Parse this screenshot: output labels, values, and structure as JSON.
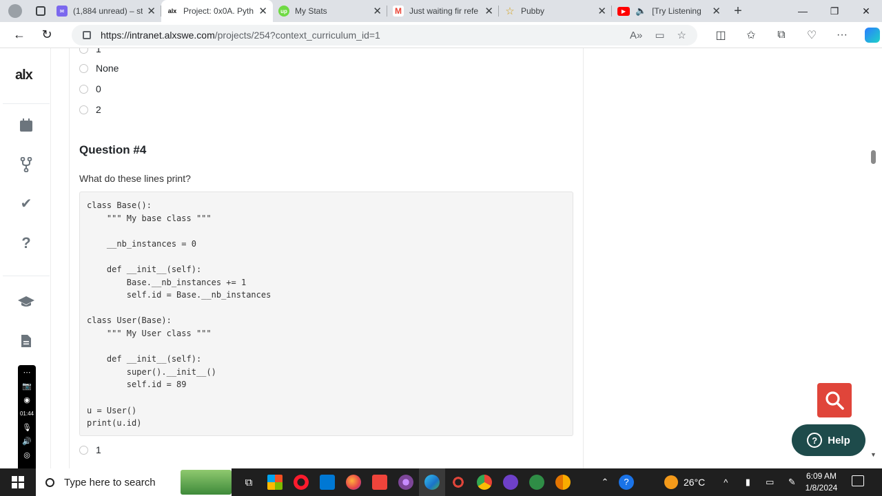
{
  "browser": {
    "tabs": [
      {
        "title": "(1,884 unread) – st",
        "favicon": "mail-icon",
        "color": "#7b68ee",
        "active": false
      },
      {
        "title": "Project: 0x0A. Pyth",
        "favicon": "alx-icon",
        "color": "#111111",
        "active": true
      },
      {
        "title": "My Stats",
        "favicon": "upwork-icon",
        "color": "#6fda44",
        "active": false
      },
      {
        "title": "Just waiting fir refe",
        "favicon": "gmail-icon",
        "color": "#ea4335",
        "active": false
      },
      {
        "title": "Pubby",
        "favicon": "star-icon",
        "color": "#f1c40f",
        "active": false
      },
      {
        "title": "[Try Listening",
        "favicon": "youtube-icon",
        "color": "#ff0000",
        "active": false
      }
    ],
    "url_host": "https://intranet.alxswe.com",
    "url_path": "/projects/254?context_curriculum_id=1"
  },
  "sidebar": {
    "logo": "alx"
  },
  "quiz": {
    "prev_options": [
      "1",
      "None",
      "0",
      "2"
    ],
    "question_title": "Question #4",
    "question_text": "What do these lines print?",
    "code": "class Base():\n    \"\"\" My base class \"\"\"\n\n    __nb_instances = 0\n\n    def __init__(self):\n        Base.__nb_instances += 1\n        self.id = Base.__nb_instances\n\nclass User(Base):\n    \"\"\" My User class \"\"\"\n\n    def __init__(self):\n        super().__init__()\n        self.id = 89\n\nu = User()\nprint(u.id)",
    "next_options": [
      "1"
    ]
  },
  "widgets": {
    "help_label": "Help",
    "recorder_time": "01:44"
  },
  "taskbar": {
    "search_placeholder": "Type here to search",
    "temperature": "26°C",
    "time": "6:09 AM",
    "date": "1/8/2024"
  },
  "colors": {
    "accent_red": "#e0453a",
    "help_bg": "#1e4b4b"
  }
}
